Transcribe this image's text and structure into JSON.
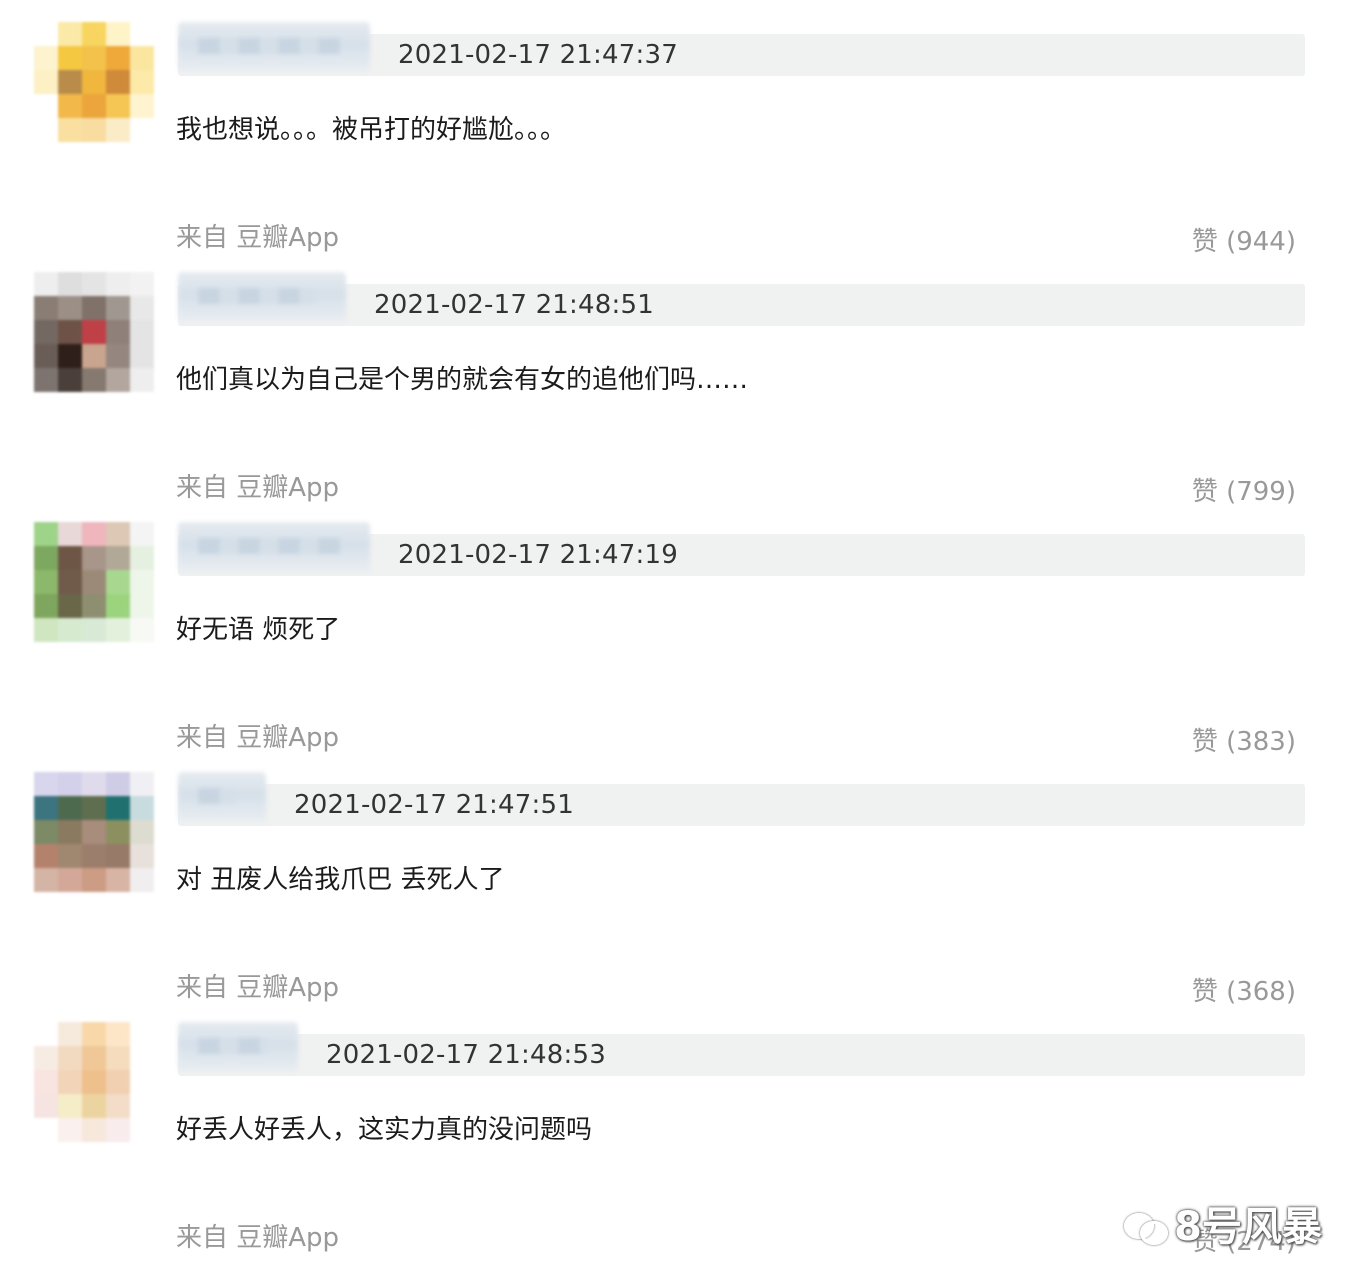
{
  "comments": [
    {
      "timestamp": "2021-02-17 21:47:37",
      "text": "我也想说。。。被吊打的好尴尬。。。",
      "source": "来自 豆瓣App",
      "likes": "赞 (944)"
    },
    {
      "timestamp": "2021-02-17 21:48:51",
      "text": "他们真以为自己是个男的就会有女的追他们吗……",
      "source": "来自 豆瓣App",
      "likes": "赞 (799)"
    },
    {
      "timestamp": "2021-02-17 21:47:19",
      "text": "好无语 烦死了",
      "source": "来自 豆瓣App",
      "likes": "赞 (383)"
    },
    {
      "timestamp": "2021-02-17 21:47:51",
      "text": "对 丑废人给我爪巴 丢死人了",
      "source": "来自 豆瓣App",
      "likes": "赞 (368)"
    },
    {
      "timestamp": "2021-02-17 21:48:53",
      "text": "好丢人好丢人，这实力真的没问题吗",
      "source": "来自 豆瓣App",
      "likes": "赞 (274)"
    }
  ],
  "watermark": {
    "text": "8号风暴",
    "icon": "wechat-icon"
  },
  "avatar_palettes": [
    [
      "#ffffff",
      "#fbe9a8",
      "#f7d560",
      "#fff3c8",
      "#ffffff",
      "#fdf3cf",
      "#f5c842",
      "#f3c24b",
      "#eea93a",
      "#fbe6a0",
      "#fdf0c4",
      "#b98c4a",
      "#f0b63d",
      "#cf8a3a",
      "#fde9a8",
      "#ffffff",
      "#f3b84a",
      "#eba53c",
      "#f5c653",
      "#fff3d0",
      "#ffffff",
      "#f9e0a0",
      "#f8dca0",
      "#fbecc8",
      "#ffffff"
    ],
    [
      "#eeeeee",
      "#dedede",
      "#e4e4e4",
      "#eeeeee",
      "#f2f2f2",
      "#8a7d74",
      "#9c8f86",
      "#807268",
      "#a09890",
      "#e8e8e8",
      "#746862",
      "#6e5247",
      "#c04048",
      "#8f8079",
      "#e4e4e4",
      "#6a5d58",
      "#2e1f1a",
      "#c9a48e",
      "#958680",
      "#e4e4e4",
      "#7d7470",
      "#4a3f3b",
      "#86796f",
      "#b2a69e",
      "#eeeeee"
    ],
    [
      "#9ed38a",
      "#e8d8d8",
      "#efb6be",
      "#dcc8b4",
      "#f4f4f4",
      "#7da860",
      "#6e5646",
      "#a8968a",
      "#b2a898",
      "#e6f0e0",
      "#8bb86a",
      "#705a4a",
      "#9c8a78",
      "#a8d890",
      "#eef5ea",
      "#7ea65e",
      "#6a6648",
      "#8e8e70",
      "#9cd47e",
      "#eef6ea",
      "#d0e6c0",
      "#d6ead0",
      "#d8ead6",
      "#e2f0dc",
      "#f6f9f4"
    ],
    [
      "#d8d6ec",
      "#d3d1e9",
      "#e0dbec",
      "#cfcde6",
      "#f0f0f4",
      "#3c7480",
      "#4e6a4e",
      "#5e6e4e",
      "#207070",
      "#c8dce0",
      "#7c8a66",
      "#8a7a60",
      "#a88c7c",
      "#8c9060",
      "#dcdcd0",
      "#b4826c",
      "#a08870",
      "#9c7e6c",
      "#987a68",
      "#e8e0da",
      "#d4b4a4",
      "#d4a898",
      "#cc9c84",
      "#d8b4a4",
      "#f0eeee"
    ],
    [
      "#ffffff",
      "#f6eadc",
      "#f8d8a8",
      "#fde6c8",
      "#ffffff",
      "#f7ece4",
      "#f2dac0",
      "#f0c898",
      "#f4dcbc",
      "#ffffff",
      "#f8e4e0",
      "#f2d4b8",
      "#eec08c",
      "#f0d0b0",
      "#ffffff",
      "#f6e4e2",
      "#f5ecc8",
      "#ecd4a0",
      "#f3dcc8",
      "#ffffff",
      "#ffffff",
      "#faf0ee",
      "#f7e8dc",
      "#f8ecec",
      "#ffffff"
    ]
  ],
  "name_blur_widths": [
    192,
    168,
    192,
    88,
    120
  ]
}
